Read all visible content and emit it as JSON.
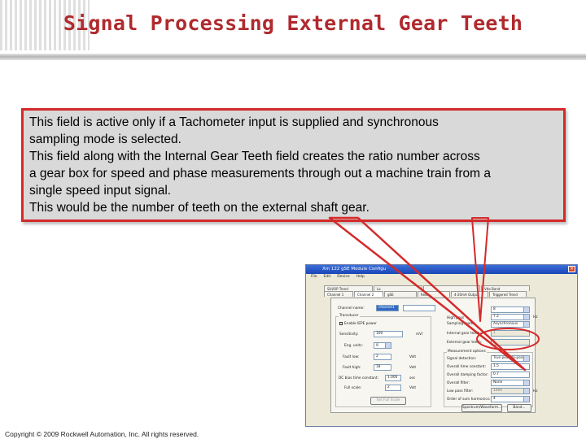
{
  "slide": {
    "title": "Signal Processing External Gear Teeth",
    "footer": "Copyright © 2009 Rockwell Automation, Inc. All rights reserved."
  },
  "callout": {
    "line1": "This field is active only if a Tachometer input is supplied and synchronous",
    "line2": "sampling mode is selected.",
    "line3": "This field along with the Internal Gear Teeth field creates the ratio number across",
    "line4": "a gear box for speed and phase measurements through out a machine train from a",
    "line5": "single speed input signal.",
    "line6": "This would be the number of teeth on the external shaft gear."
  },
  "dialog": {
    "title": "Xm 122 gSE Module Configu",
    "menu": [
      "File",
      "Edit",
      "Device",
      "Help"
    ],
    "tabs_row1": [
      "SUI/OP Trend",
      "Lo",
      "",
      "Vda Band"
    ],
    "tabs_row2": [
      "Channel 1",
      "Channel 2",
      "gSE",
      "Rela",
      "4-20mA Output",
      "Triggered Trend"
    ],
    "left": {
      "channel_name_label": "Channel name:",
      "channel_name_value": "channel1",
      "transducer_group": "Transducer",
      "enable_iepe": "Enable IEPE power",
      "sensitivity_label": "Sensitivity:",
      "sensitivity_value": "100",
      "sensitivity_unit": "mV/",
      "eng_units_label": "Eng. units:",
      "eng_units_value": "g",
      "fault_low_label": "Fault low:",
      "fault_low_value": "2",
      "fault_low_unit": "Volt",
      "fault_high_label": "Fault high:",
      "fault_high_value": "18",
      "fault_high_unit": "Volt",
      "dc_bias_label": "DC bias time constant:",
      "dc_bias_value": "1.000",
      "dc_bias_unit": "sec",
      "full_scale_label": "Full scale:",
      "full_scale_value": "2",
      "full_scale_unit": "Volt",
      "button": "Set Full Scale"
    },
    "right": {
      "high_pass_label": "High pass",
      "high_pass_value": "8",
      "sampling_label": "Sampling mode:",
      "sampling_value": "7.2",
      "sampling_unit": "Hz",
      "mode_value": "Asynchronous",
      "internal_gear_label": "Internal gear teeth:",
      "internal_gear_value": "1",
      "external_gear_label": "External gear teeth:",
      "external_gear_value": "1",
      "measurement_group": "Measurement options",
      "signal_detection_label": "Signal detection:",
      "signal_detection_value": "True peak-to-peak",
      "overall_time_label": "Overall time constant:",
      "overall_time_value": "1.5",
      "overall_damping_label": "Overall damping factor:",
      "overall_damping_value": "0.7",
      "overall_filter_label": "Overall filter:",
      "overall_filter_value": "None",
      "low_pass_label": "Low pass filter:",
      "low_pass_value": "1000",
      "low_pass_unit": "Hz",
      "order_label": "Order of sum harmonics:",
      "order_value": "4",
      "spectrum_button": "Spectrum/Waveform...",
      "band_button": "Band..."
    }
  },
  "colors": {
    "title": "#b02a2e",
    "callout_border": "#d42a2a",
    "callout_fill": "#d9d9d9"
  }
}
